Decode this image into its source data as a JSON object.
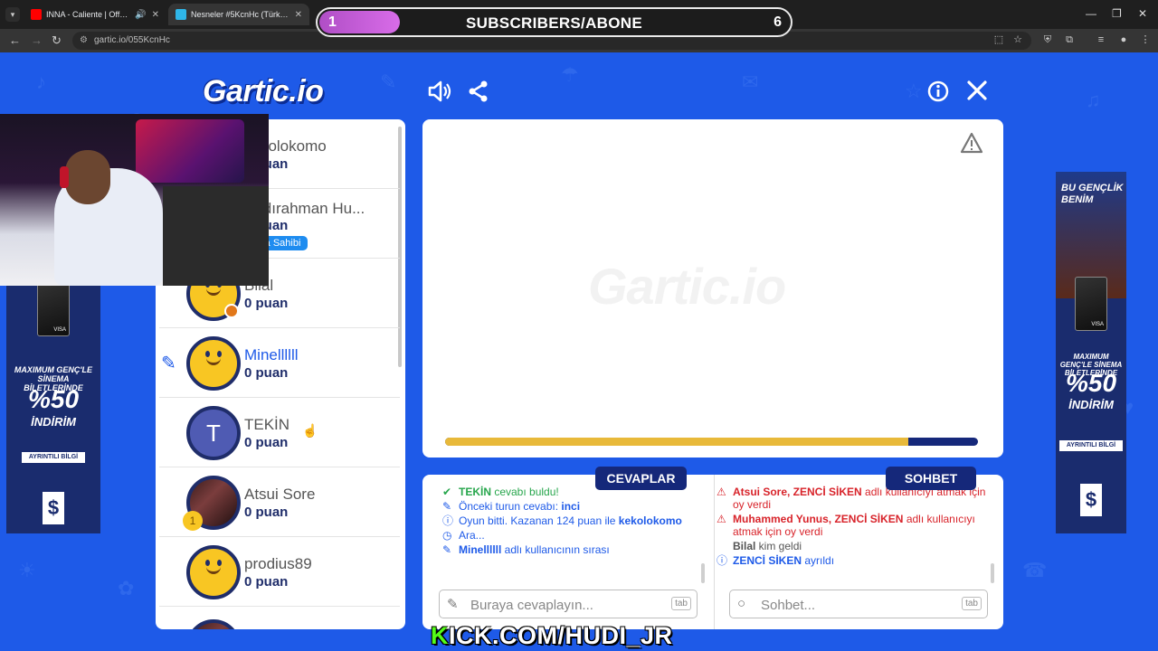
{
  "browser": {
    "tabs": [
      {
        "label": "INNA - Caliente | Official M",
        "favicon_color": "#ff0000",
        "audio": true
      },
      {
        "label": "Nesneler #5KcnHc (Türkçe) - G",
        "favicon_color": "#2fb6e8",
        "active": true
      }
    ],
    "url": "gartic.io/055KcnHc"
  },
  "overlay": {
    "subscribers_title": "SUBSCRIBERS/ABONE",
    "current": "1",
    "goal": "6",
    "goal_fraction": 0.17,
    "kick_prefix": "K",
    "kick_rest": "ICK.COM/HUDI_JR"
  },
  "header": {
    "logo": "Gartic.io",
    "icons": [
      "sound-icon",
      "share-icon",
      "info-icon",
      "close-icon"
    ]
  },
  "players": [
    {
      "name": "kekolokomo",
      "score": "0 puan",
      "avatar": "photo"
    },
    {
      "name": "Abdırahman Hu...",
      "score": "0 puan",
      "badge": "Oda Sahibi",
      "avatar": "photo"
    },
    {
      "name": "Bilal",
      "score": "0 puan",
      "avatar": "yellow"
    },
    {
      "name": "Minellllll",
      "score": "0 puan",
      "avatar": "yellow",
      "drawing": true
    },
    {
      "name": "TEKİN",
      "score": "0 puan",
      "avatar": "letter",
      "letter": "T"
    },
    {
      "name": "Atsui Sore",
      "score": "0 puan",
      "avatar": "photo",
      "trophy": "1"
    },
    {
      "name": "prodius89",
      "score": "0 puan",
      "avatar": "yellow"
    }
  ],
  "canvas": {
    "watermark": "Gartic.io",
    "timer_fraction": 0.87
  },
  "answers": {
    "tab": "CEVAPLAR",
    "messages": [
      {
        "icon": "check-icon",
        "color": "green",
        "bold": "TEKİN",
        "text": " cevabı buldu!"
      },
      {
        "icon": "pencil-icon",
        "color": "blue",
        "text": "Önceki turun cevabı: ",
        "bold_end": "inci"
      },
      {
        "icon": "info-icon",
        "color": "blue",
        "text": "Oyun bitti. Kazanan 124 puan ile ",
        "bold_end": "kekolokomo"
      },
      {
        "icon": "clock-icon",
        "color": "blue",
        "text": "Ara..."
      },
      {
        "icon": "pencil-icon",
        "color": "blue",
        "bold": "Minellllll",
        "text": " adlı kullanıcının sırası"
      }
    ],
    "placeholder": "Buraya cevaplayın...",
    "tab_hint": "tab"
  },
  "chat": {
    "tab": "SOHBET",
    "messages": [
      {
        "icon": "warning-icon",
        "color": "red",
        "bold": "Atsui Sore, ZENCİ SİKEN",
        "text": " adlı kullanıcıyı atmak için oy verdi"
      },
      {
        "icon": "warning-icon",
        "color": "red",
        "bold": "Muhammed Yunus, ZENCİ SİKEN",
        "text": " adlı kullanıcıyı atmak için oy verdi"
      },
      {
        "color": "gray",
        "bold": "Bilal",
        "text": " kim geldi"
      },
      {
        "icon": "info-icon",
        "color": "blue",
        "bold": "ZENCİ SİKEN",
        "text": " ayrıldı"
      }
    ],
    "placeholder": "Sohbet...",
    "tab_hint": "tab"
  },
  "ads": {
    "left": {
      "headline": "MAXIMUM GENÇ'LE SİNEMA BİLETLERİNDE",
      "percent": "%50",
      "sub": "İNDİRİM",
      "more": "AYRINTILI BİLGİ",
      "card": "VISA"
    },
    "right": {
      "title": "BU GENÇLİK BENİM",
      "headline": "MAXIMUM GENÇ'LE SİNEMA BİLETLERİNDE",
      "percent": "%50",
      "sub": "İNDİRİM",
      "more": "AYRINTILI BİLGİ",
      "card": "VISA"
    }
  }
}
